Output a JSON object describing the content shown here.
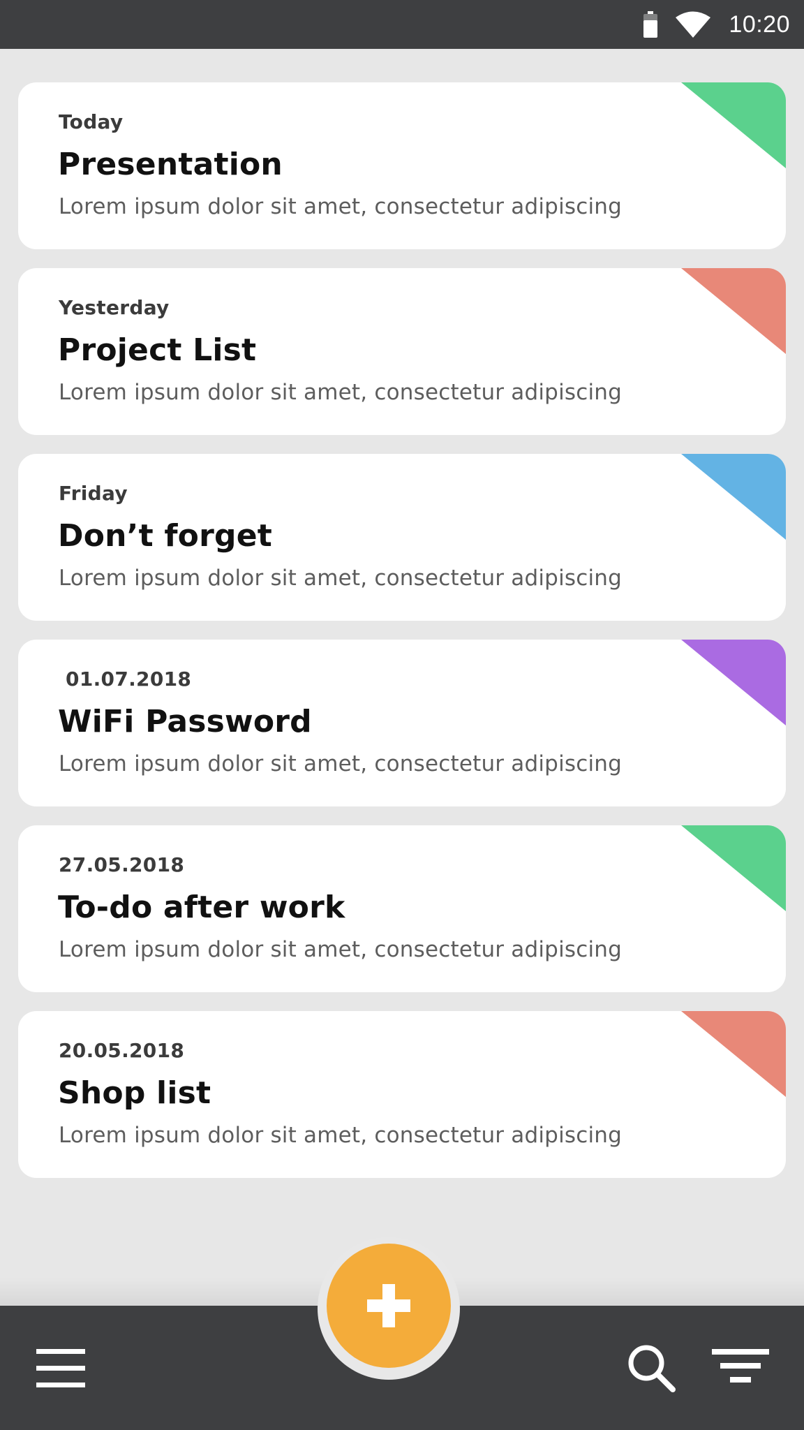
{
  "status_bar": {
    "time": "10:20",
    "icons": [
      "battery-icon",
      "wifi-icon"
    ]
  },
  "notes": [
    {
      "date": "Today",
      "title": "Presentation",
      "description": "Lorem ipsum dolor sit amet, consectetur adipiscing",
      "color": "#5bd18d"
    },
    {
      "date": "Yesterday",
      "title": "Project List",
      "description": "Lorem ipsum dolor sit amet, consectetur adipiscing",
      "color": "#e88878"
    },
    {
      "date": "Friday",
      "title": "Don’t forget",
      "description": "Lorem ipsum dolor sit amet, consectetur adipiscing",
      "color": "#63b3e4"
    },
    {
      "date": " 01.07.2018",
      "title": "WiFi Password",
      "description": "Lorem ipsum dolor sit amet, consectetur adipiscing",
      "color": "#aa6be2"
    },
    {
      "date": "27.05.2018",
      "title": "To-do after work",
      "description": "Lorem ipsum dolor sit amet, consectetur adipiscing",
      "color": "#5bd18d"
    },
    {
      "date": "20.05.2018",
      "title": "Shop list",
      "description": "Lorem ipsum dolor sit amet, consectetur adipiscing",
      "color": "#e88878"
    }
  ],
  "bottom_bar": {
    "icons": [
      "menu-icon",
      "plus-icon",
      "search-icon",
      "filter-icon"
    ],
    "fab_color": "#f4ac3a",
    "bar_color": "#3e3f41"
  }
}
